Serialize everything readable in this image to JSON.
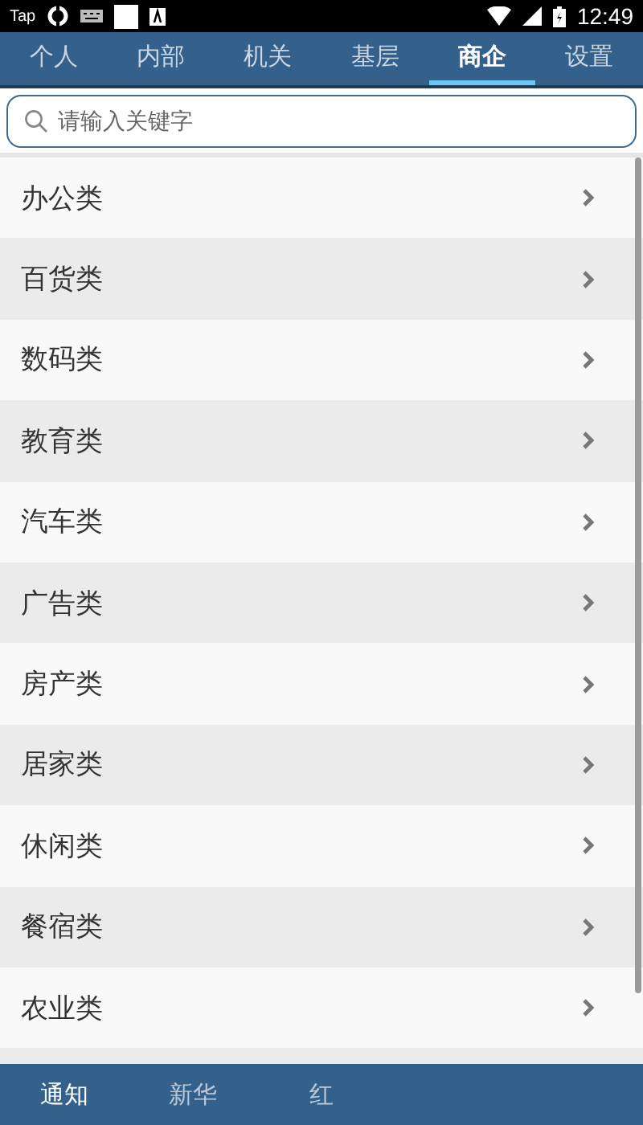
{
  "status_bar": {
    "app_label": "Tap",
    "time": "12:49"
  },
  "tabs": [
    {
      "label": "个人",
      "selected": false
    },
    {
      "label": "内部",
      "selected": false
    },
    {
      "label": "机关",
      "selected": false
    },
    {
      "label": "基层",
      "selected": false
    },
    {
      "label": "商企",
      "selected": true
    },
    {
      "label": "设置",
      "selected": false
    }
  ],
  "search": {
    "placeholder": "请输入关键字"
  },
  "list": {
    "items": [
      "办公类",
      "百货类",
      "数码类",
      "教育类",
      "汽车类",
      "广告类",
      "房产类",
      "居家类",
      "休闲类",
      "餐宿类",
      "农业类"
    ]
  },
  "bottom_nav": [
    {
      "label": "通知",
      "selected": true
    },
    {
      "label": "新华",
      "selected": false
    },
    {
      "label": "红",
      "selected": false
    }
  ]
}
